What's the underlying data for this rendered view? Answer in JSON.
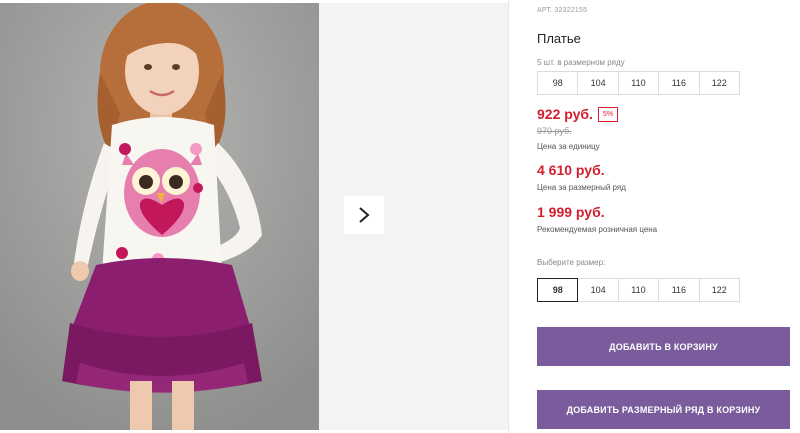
{
  "gallery": {
    "photo_alt": "Girl in white long-sleeve dress with pink owl print and purple tulle skirt",
    "next_icon": "chevron-right-icon"
  },
  "product": {
    "article": "АРТ. 32322155",
    "title": "Платье",
    "size_row_note": "5 шт. в размерном ряду",
    "sizes_row": [
      "98",
      "104",
      "110",
      "116",
      "122"
    ]
  },
  "pricing": {
    "unit_price": "922 руб.",
    "discount": "5%",
    "old_price": "970 руб.",
    "unit_price_label": "Цена за единицу",
    "row_price": "4 610 руб.",
    "row_price_label": "Цена за размерный ряд",
    "retail_price": "1 999 руб.",
    "retail_price_label": "Рекомендуемая розничная цена"
  },
  "size_select": {
    "label": "Выберите размер:",
    "options": [
      "98",
      "104",
      "110",
      "116",
      "122"
    ],
    "selected": "98"
  },
  "actions": {
    "add_to_cart": "ДОБАВИТЬ В КОРЗИНУ",
    "add_row_to_cart": "ДОБАВИТЬ РАЗМЕРНЫЙ РЯД В КОРЗИНУ"
  },
  "colors": {
    "price_red": "#d21f2e",
    "button_purple": "#7a5c9c"
  }
}
